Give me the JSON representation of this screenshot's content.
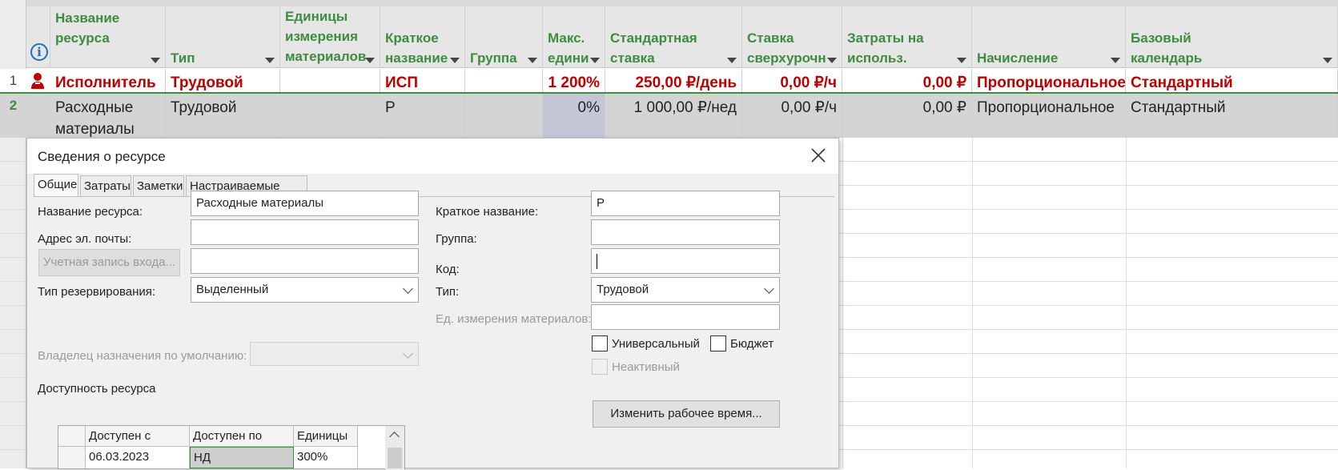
{
  "columns": [
    {
      "label": "Название\nресурса"
    },
    {
      "label": "Тип"
    },
    {
      "label": "Единицы\nизмерения\nматериалов"
    },
    {
      "label": "Краткое\nназвание"
    },
    {
      "label": "Группа"
    },
    {
      "label": "Макс.\nедини"
    },
    {
      "label": "Стандартная\nставка"
    },
    {
      "label": "Ставка\nсверхурочн"
    },
    {
      "label": "Затраты на\nиспольз."
    },
    {
      "label": "Начисление"
    },
    {
      "label": "Базовый\nкалендарь"
    }
  ],
  "rows": [
    {
      "num": "1",
      "name": "Исполнитель",
      "type": "Трудовой",
      "units": "",
      "short": "ИСП",
      "group": "",
      "max": "1 200%",
      "std": "250,00 ₽/день",
      "ovt": "0,00 ₽/ч",
      "cost": "0,00 ₽",
      "accrue": "Пропорциональное",
      "calendar": "Стандартный"
    },
    {
      "num": "2",
      "name": "Расходные\nматериалы",
      "type": "Трудовой",
      "units": "",
      "short": "Р",
      "group": "",
      "max": "0%",
      "std": "1 000,00 ₽/нед",
      "ovt": "0,00 ₽/ч",
      "cost": "0,00 ₽",
      "accrue": "Пропорциональное",
      "calendar": "Стандартный"
    }
  ],
  "dialog": {
    "title": "Сведения о ресурсе",
    "tabs": [
      "Общие",
      "Затраты",
      "Заметки",
      "Настраиваемые поля"
    ],
    "resource_name_label": "Название ресурса:",
    "resource_name_value": "Расходные материалы",
    "email_label": "Адрес эл. почты:",
    "email_value": "",
    "account_button": "Учетная запись входа...",
    "account_value": "",
    "booking_label": "Тип резервирования:",
    "booking_value": "Выделенный",
    "owner_label": "Владелец назначения по умолчанию:",
    "owner_value": "",
    "short_name_label": "Краткое название:",
    "short_name_value": "Р",
    "group_label": "Группа:",
    "group_value": "",
    "code_label": "Код:",
    "code_value": "",
    "type_label": "Тип:",
    "type_value": "Трудовой",
    "material_units_label": "Ед. измерения материалов:",
    "material_units_value": "",
    "generic_label": "Универсальный",
    "budget_label": "Бюджет",
    "inactive_label": "Неактивный",
    "availability_label": "Доступность ресурса",
    "availability_headers": [
      "Доступен с",
      "Доступен по",
      "Единицы"
    ],
    "availability_rows": [
      {
        "from": "06.03.2023",
        "to": "НД",
        "units": "300%"
      }
    ],
    "change_time_button": "Изменить рабочее время..."
  },
  "colors": {
    "header_text": "#3f8b3f",
    "overallocated": "#c00000",
    "info_icon": "#1f6fc5"
  }
}
